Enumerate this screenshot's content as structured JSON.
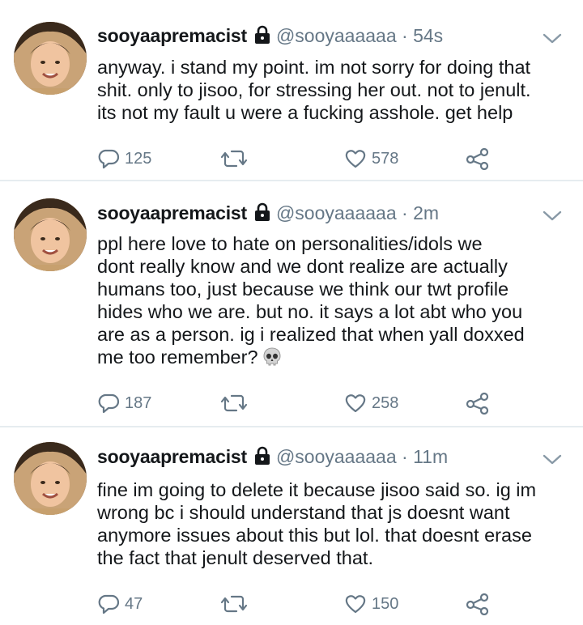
{
  "tweets": [
    {
      "display_name": "sooyaapremacist",
      "handle": "@sooyaaaaaa",
      "dot": "·",
      "time": "54s",
      "lines": [
        "anyway. i stand my point. im not sorry for doing that",
        "shit. only to jisoo, for stressing her out. not to jenult.",
        "its not my fault u were a fucking asshole. get help"
      ],
      "replies": "125",
      "retweets": "",
      "likes": "578"
    },
    {
      "display_name": "sooyaapremacist",
      "handle": "@sooyaaaaaa",
      "dot": "·",
      "time": "2m",
      "lines": [
        "ppl here love to hate on personalities/idols we",
        "dont really know and we dont realize are actually",
        "humans too, just because we think our twt profile",
        "hides who we are. but no. it says a lot abt who you",
        "are as a person. ig i realized that when yall doxxed",
        "me too remember?"
      ],
      "emoji": "skull-icon",
      "replies": "187",
      "retweets": "",
      "likes": "258"
    },
    {
      "display_name": "sooyaapremacist",
      "handle": "@sooyaaaaaa",
      "dot": "·",
      "time": "11m",
      "lines": [
        "fine im going to delete it because jisoo said so. ig im",
        "wrong bc i should understand that js doesnt want",
        "anymore issues about this but lol. that doesnt erase",
        "the fact that jenult deserved that."
      ],
      "replies": "47",
      "retweets": "",
      "likes": "150"
    }
  ],
  "colors": {
    "text": "#14171a",
    "secondary": "#657786",
    "divider": "#e6ecf0"
  },
  "icons": [
    "lock-icon",
    "chevron-down-icon",
    "reply-icon",
    "retweet-icon",
    "like-icon",
    "share-icon",
    "skull-icon"
  ]
}
